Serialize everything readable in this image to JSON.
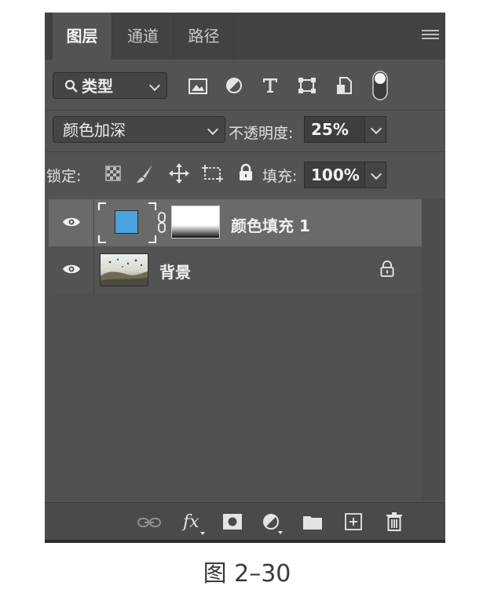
{
  "panel": {
    "tabs": [
      {
        "label": "图层",
        "active": true
      },
      {
        "label": "通道",
        "active": false
      },
      {
        "label": "路径",
        "active": false
      }
    ],
    "filter": {
      "label": "类型",
      "icons": [
        "image-filter-icon",
        "adjustment-filter-icon",
        "type-filter-icon",
        "shape-filter-icon",
        "smart-object-filter-icon",
        "filter-toggle-icon"
      ]
    },
    "blend_mode": "颜色加深",
    "opacity": {
      "label": "不透明度:",
      "value": "25%"
    },
    "lock": {
      "label": "锁定:",
      "icons": [
        "lock-transparent-pixels-icon",
        "lock-image-pixels-icon",
        "lock-position-icon",
        "lock-artboard-icon",
        "lock-all-icon"
      ]
    },
    "fill": {
      "label": "填充:",
      "value": "100%"
    },
    "layers": [
      {
        "name": "颜色填充 1",
        "visible": true,
        "selected": true,
        "thumbnail_color": "#4aa3df",
        "locked": false
      },
      {
        "name": "背景",
        "visible": true,
        "selected": false,
        "locked": true
      }
    ],
    "bottom_icons": [
      "link-layers-icon",
      "fx-icon",
      "add-mask-icon",
      "adjustment-layer-icon",
      "new-group-icon",
      "new-layer-icon",
      "delete-layer-icon"
    ]
  },
  "caption": "图 2–30"
}
